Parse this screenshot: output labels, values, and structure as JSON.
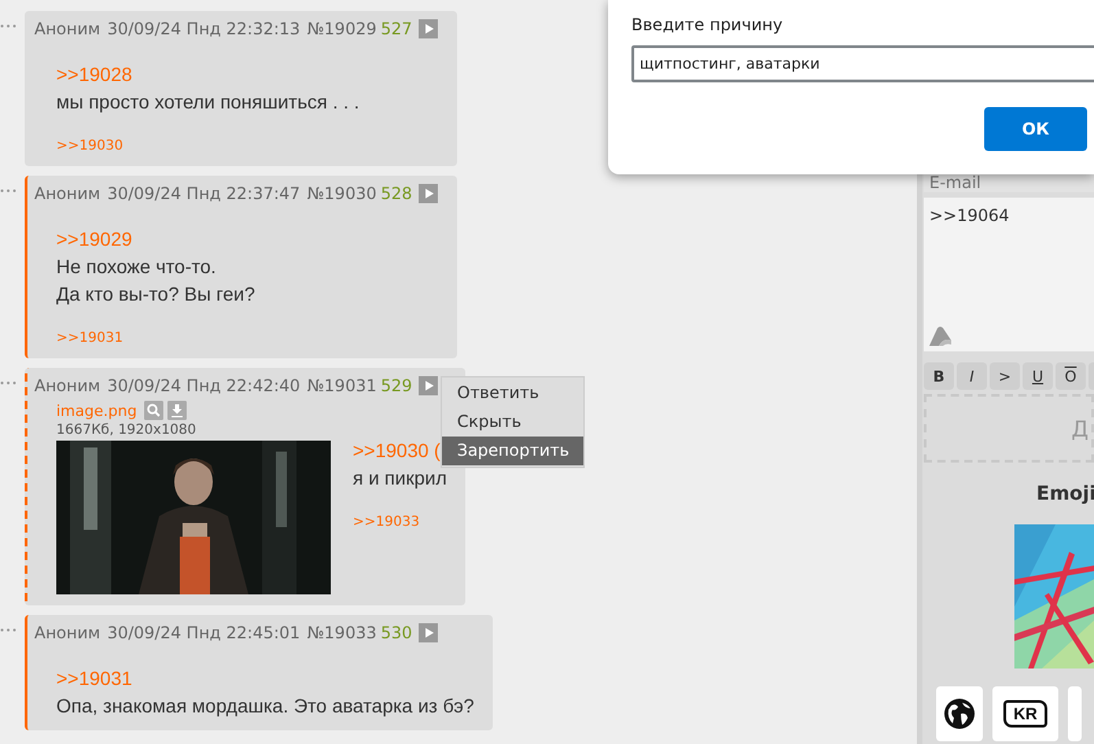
{
  "posts": [
    {
      "author": "Аноним",
      "date": "30/09/24 Пнд 22:32:13",
      "number": "№19029",
      "count": "527",
      "kind": "plain",
      "quotes": [
        ">>19028"
      ],
      "lines": [
        "мы просто хотели поняшиться . . ."
      ],
      "replies": [
        ">>19030"
      ]
    },
    {
      "author": "Аноним",
      "date": "30/09/24 Пнд 22:37:47",
      "number": "№19030",
      "count": "528",
      "kind": "solid",
      "quotes": [
        ">>19029"
      ],
      "lines": [
        "Не похоже что-то.",
        "Да кто вы-то? Вы геи?"
      ],
      "replies": [
        ">>19031"
      ]
    },
    {
      "author": "Аноним",
      "date": "30/09/24 Пнд 22:42:40",
      "number": "№19031",
      "count": "529",
      "kind": "dashed",
      "file": {
        "name": "image.png",
        "meta": "1667Кб, 1920x1080",
        "kind": "picture"
      },
      "quotes": [
        ">>19030 ("
      ],
      "lines": [
        "я и пикрил"
      ],
      "replies": [
        ">>19033"
      ],
      "menu": [
        {
          "label": "Ответить",
          "selected": false
        },
        {
          "label": "Скрыть",
          "selected": false
        },
        {
          "label": "Зарепортить",
          "selected": true
        }
      ]
    },
    {
      "author": "Аноним",
      "date": "30/09/24 Пнд 22:45:01",
      "number": "№19033",
      "count": "530",
      "kind": "solid",
      "quotes": [
        ">>19031"
      ],
      "lines": [
        "Опа, знакомая мордашка. Это аватарка из бэ?"
      ]
    }
  ],
  "form": {
    "email": {
      "placeholder": "E-mail"
    },
    "message": {
      "value": ">>19064"
    },
    "toolbar": [
      {
        "label": "B",
        "kind": "bold"
      },
      {
        "label": "I",
        "kind": "italic"
      },
      {
        "label": ">",
        "kind": "plain"
      },
      {
        "label": "U",
        "kind": "underline"
      },
      {
        "label": "O",
        "kind": "overline"
      }
    ],
    "dropzone": "Д",
    "emoji_title": "Emoji",
    "emoji_tiles": [
      {
        "kind": "globe"
      },
      {
        "kind": "flag",
        "label": "KR"
      },
      {
        "kind": "blank"
      }
    ]
  },
  "dialog": {
    "label": "Введите причину",
    "value": "щитпостинг, аватарки",
    "button": "ОК"
  }
}
